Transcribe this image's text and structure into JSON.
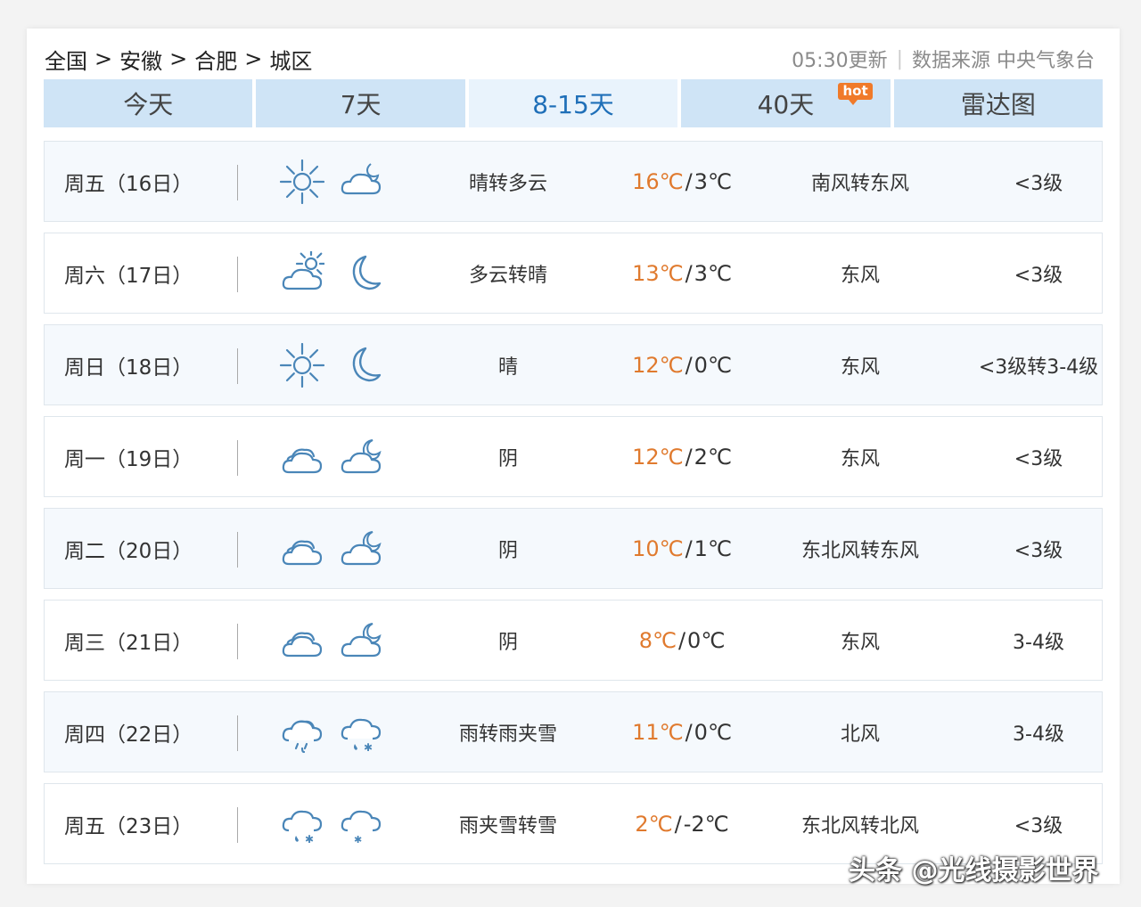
{
  "breadcrumb": [
    "全国",
    "安徽",
    "合肥",
    "城区"
  ],
  "breadcrumb_sep": ">",
  "update_time": "05:30更新",
  "source": "数据来源 中央气象台",
  "tabs": [
    {
      "label": "今天"
    },
    {
      "label": "7天"
    },
    {
      "label": "8-15天",
      "active": true
    },
    {
      "label": "40天",
      "badge": "hot"
    },
    {
      "label": "雷达图"
    }
  ],
  "forecast": [
    {
      "day": "周五（16日）",
      "icon_day": "sunny-icon",
      "icon_night": "cloudy-moon-icon",
      "desc": "晴转多云",
      "high": "16℃",
      "low": "3℃",
      "wind": "南风转东风",
      "level": "<3级"
    },
    {
      "day": "周六（17日）",
      "icon_day": "partly-cloudy-icon",
      "icon_night": "moon-icon",
      "desc": "多云转晴",
      "high": "13℃",
      "low": "3℃",
      "wind": "东风",
      "level": "<3级"
    },
    {
      "day": "周日（18日）",
      "icon_day": "sunny-icon",
      "icon_night": "moon-icon",
      "desc": "晴",
      "high": "12℃",
      "low": "0℃",
      "wind": "东风",
      "level": "<3级转3-4级"
    },
    {
      "day": "周一（19日）",
      "icon_day": "overcast-icon",
      "icon_night": "overcast-moon-icon",
      "desc": "阴",
      "high": "12℃",
      "low": "2℃",
      "wind": "东风",
      "level": "<3级"
    },
    {
      "day": "周二（20日）",
      "icon_day": "overcast-icon",
      "icon_night": "overcast-moon-icon",
      "desc": "阴",
      "high": "10℃",
      "low": "1℃",
      "wind": "东北风转东风",
      "level": "<3级"
    },
    {
      "day": "周三（21日）",
      "icon_day": "overcast-icon",
      "icon_night": "overcast-moon-icon",
      "desc": "阴",
      "high": "8℃",
      "low": "0℃",
      "wind": "东风",
      "level": "3-4级"
    },
    {
      "day": "周四（22日）",
      "icon_day": "rain-icon",
      "icon_night": "sleet-icon",
      "desc": "雨转雨夹雪",
      "high": "11℃",
      "low": "0℃",
      "wind": "北风",
      "level": "3-4级"
    },
    {
      "day": "周五（23日）",
      "icon_day": "sleet-icon",
      "icon_night": "snow-icon",
      "desc": "雨夹雪转雪",
      "high": "2℃",
      "low": "-2℃",
      "wind": "东北风转北风",
      "level": "<3级"
    }
  ],
  "watermark": "头条 @光线摄影世界",
  "colors": {
    "tab": "#cfe4f6",
    "tab_active_text": "#1f6fb8",
    "high_temp": "#e07a2e",
    "icon": "#4a86b8"
  }
}
